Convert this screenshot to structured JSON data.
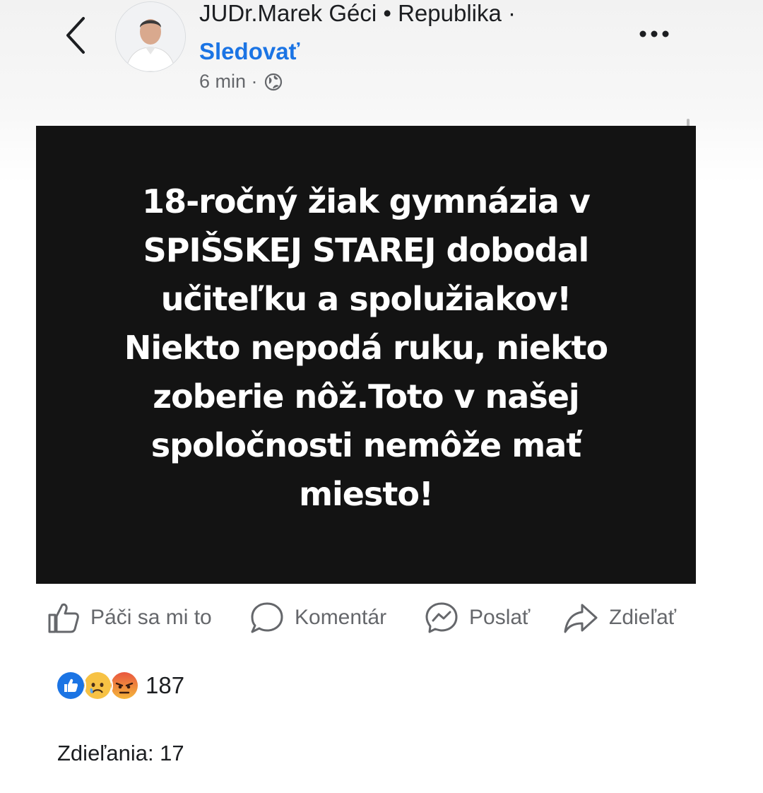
{
  "header": {
    "author": "JUDr.Marek Géci • Republika ·",
    "follow_label": "Sledovať",
    "time": "6 min ·",
    "back_icon": "chevron-left-icon",
    "more_icon": "more-dots-icon",
    "privacy_icon": "globe-icon"
  },
  "post": {
    "text": "18-ročný žiak gymnázia  v\nSPIŠSKEJ STAREJ dobodal\nučiteľku a spolužiakov!\nNiekto nepodá ruku, niekto\nzoberie nôž.Toto v našej\nspoločnosti nemôže mať\nmiesto!",
    "background": "#131313"
  },
  "actions": {
    "like": "Páči sa mi to",
    "comment": "Komentár",
    "send": "Poslať",
    "share": "Zdieľať"
  },
  "reactions": {
    "types": [
      "like",
      "sad",
      "angry"
    ],
    "count": "187"
  },
  "shares": "Zdieľania: 17",
  "colors": {
    "accent": "#1b74e4",
    "muted": "#65676b"
  }
}
